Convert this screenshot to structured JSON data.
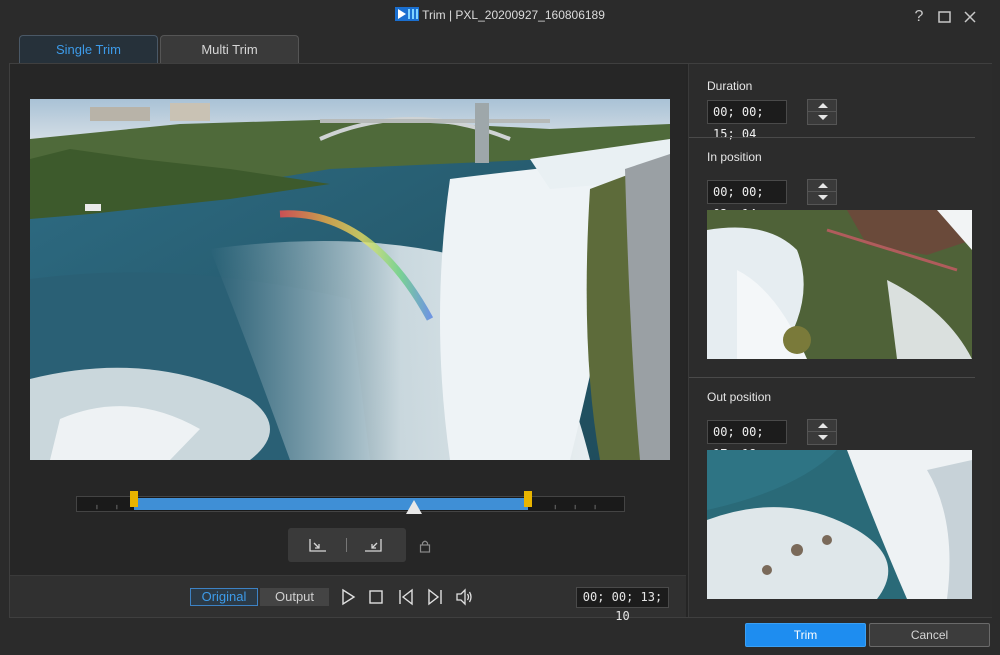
{
  "window": {
    "title": "Trim | PXL_20200927_160806189",
    "help_label": "?"
  },
  "tabs": [
    {
      "label": "Single Trim",
      "active": true
    },
    {
      "label": "Multi Trim",
      "active": false
    }
  ],
  "playback": {
    "modes": [
      {
        "label": "Original",
        "active": true
      },
      {
        "label": "Output",
        "active": false
      }
    ],
    "current_time": "00; 00; 13; 10"
  },
  "timeline": {
    "in_fraction": 0.104,
    "out_fraction": 0.825,
    "playhead_fraction": 0.617
  },
  "panel": {
    "duration": {
      "label": "Duration",
      "value": "00; 00; 15; 04"
    },
    "in_position": {
      "label": "In position",
      "value": "00; 00; 02; 14"
    },
    "out_position": {
      "label": "Out position",
      "value": "00; 00; 17; 18"
    }
  },
  "buttons": {
    "trim": "Trim",
    "cancel": "Cancel"
  },
  "colors": {
    "accent": "#3d9be9",
    "primary_button": "#1e8df0",
    "marker": "#e8b400",
    "selection": "#3f8fd6"
  }
}
